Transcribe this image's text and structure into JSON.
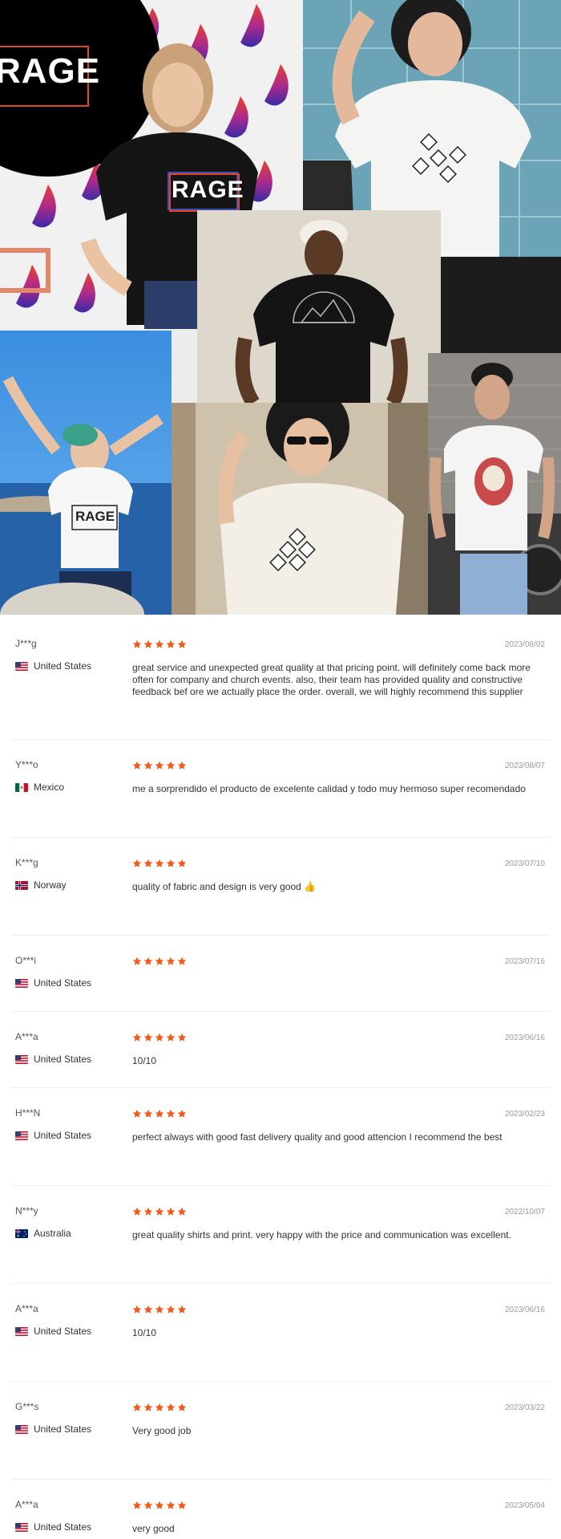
{
  "collage": {
    "photos": [
      {
        "name": "rage-shirt-woman-photo",
        "print": "RAGE"
      },
      {
        "name": "vase-shirt-woman-photo",
        "print": ""
      },
      {
        "name": "mountain-shirt-man-photo",
        "print": ""
      },
      {
        "name": "rage-shirt-girl-photo",
        "print": "RAGE"
      },
      {
        "name": "vase-shirt-sunglasses-photo",
        "print": ""
      },
      {
        "name": "skull-shirt-biker-photo",
        "print": ""
      }
    ],
    "logo_text": "RAGE"
  },
  "reviews": [
    {
      "user": "J***g",
      "country": "United States",
      "flag": "us",
      "rating": 5,
      "date": "2023/08/02",
      "text": "great service and unexpected great quality at that pricing point. will definitely come back more often for company and church events. also, their team has provided quality and constructive feedback bef ore we actually place the order. overall, we will highly recommend this supplier"
    },
    {
      "user": "Y***o",
      "country": "Mexico",
      "flag": "mx",
      "rating": 5,
      "date": "2023/08/07",
      "text": "me a sorprendido el producto de excelente calidad y todo muy hermoso super recomendado"
    },
    {
      "user": "K***g",
      "country": "Norway",
      "flag": "no",
      "rating": 5,
      "date": "2023/07/10",
      "text": "quality of fabric and design is very good 👍"
    },
    {
      "user": "O***i",
      "country": "United States",
      "flag": "us",
      "rating": 5,
      "date": "2023/07/16",
      "text": ""
    },
    {
      "user": "A***a",
      "country": "United States",
      "flag": "us",
      "rating": 5,
      "date": "2023/06/16",
      "text": "10/10"
    },
    {
      "user": "H***N",
      "country": "United States",
      "flag": "us",
      "rating": 5,
      "date": "2023/02/23",
      "text": "perfect always with good fast delivery quality and good attencion I recommend the best"
    },
    {
      "user": "N***y",
      "country": "Australia",
      "flag": "au",
      "rating": 5,
      "date": "2022/10/07",
      "text": "great quality shirts and print. very happy with the price and communication was excellent."
    },
    {
      "user": "A***a",
      "country": "United States",
      "flag": "us",
      "rating": 5,
      "date": "2023/06/16",
      "text": "10/10"
    },
    {
      "user": "G***s",
      "country": "United States",
      "flag": "us",
      "rating": 5,
      "date": "2023/03/22",
      "text": "Very good job"
    },
    {
      "user": "A***a",
      "country": "United States",
      "flag": "us",
      "rating": 5,
      "date": "2023/05/04",
      "text": "very good"
    }
  ],
  "colors": {
    "star": "#f05a1a",
    "date": "#9a9a9a",
    "separator": "#efefef"
  }
}
